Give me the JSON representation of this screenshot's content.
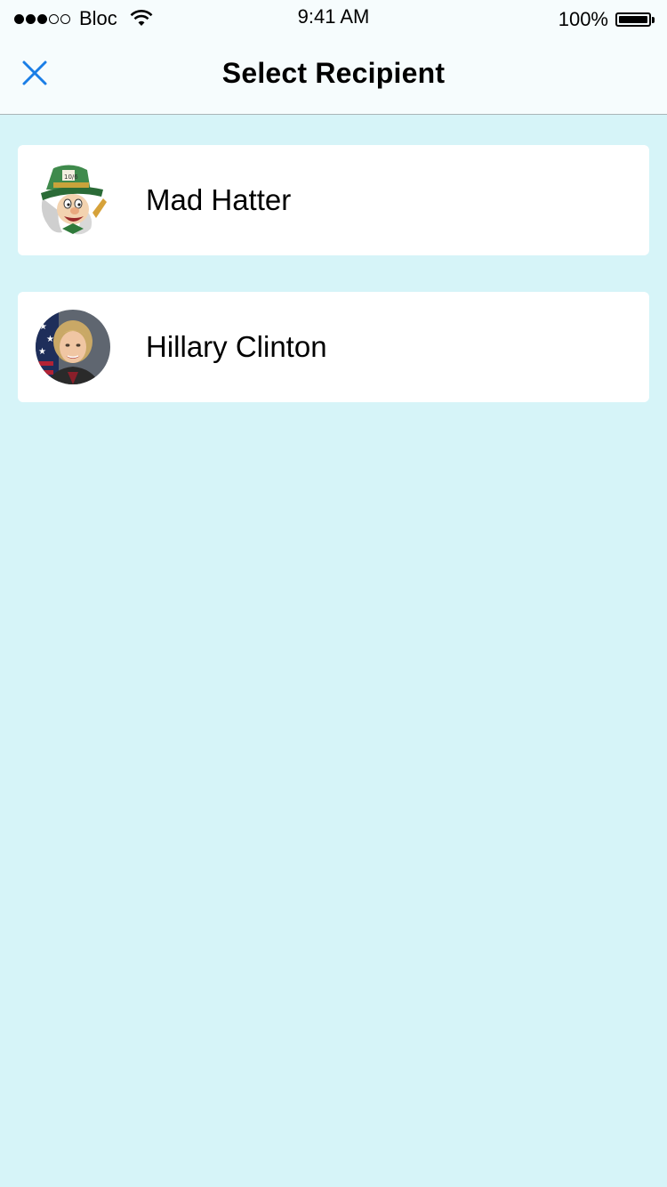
{
  "status_bar": {
    "carrier": "Bloc",
    "time": "9:41 AM",
    "battery": "100%"
  },
  "nav": {
    "title": "Select Recipient",
    "close_icon": "close-icon",
    "accent_color": "#1a7ee6"
  },
  "recipients": [
    {
      "name": "Mad Hatter",
      "avatar_icon": "mad-hatter-avatar"
    },
    {
      "name": "Hillary Clinton",
      "avatar_icon": "hillary-clinton-avatar"
    }
  ],
  "colors": {
    "background": "#d6f4f8",
    "card": "#ffffff",
    "nav_background": "#f6fcfd"
  }
}
